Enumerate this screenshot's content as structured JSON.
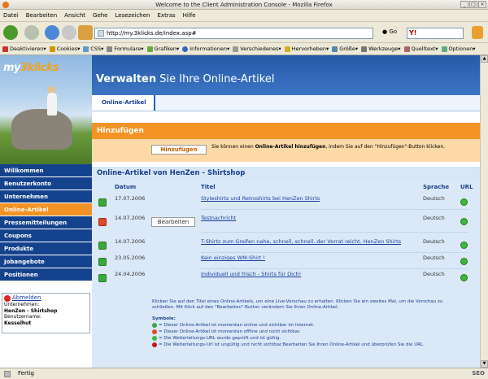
{
  "browser": {
    "title": "Welcome to the Client Administration Console - Mozilla Firefox",
    "menu": [
      "Datei",
      "Bearbeiten",
      "Ansicht",
      "Gehe",
      "Lesezeichen",
      "Extras",
      "Hilfe"
    ],
    "url": "http://my.3klicks.de/index.asp#",
    "go_label": "Go",
    "toolbar": [
      "Deaktivieren▾",
      "Cookies▾",
      "CSS▾",
      "Formulare▾",
      "Grafiken▾",
      "Informationen▾",
      "Verschiedenes▾",
      "Hervorheben▾",
      "Größe▾",
      "Werkzeuge▾",
      "Quelltext▾",
      "Optionen▾"
    ],
    "status": "Fertig",
    "status_right": "SEO"
  },
  "site": {
    "logo_a": "my",
    "logo_b": "3klicks",
    "header_bold": "Verwalten",
    "header_rest": " Sie Ihre Online-Artikel",
    "tab": "Online-Artikel",
    "nav": [
      {
        "label": "Willkommen",
        "active": false
      },
      {
        "label": "Benutzerkonto",
        "active": false
      },
      {
        "label": "Unternehmen",
        "active": false
      },
      {
        "label": "Online-Artikel",
        "active": true
      },
      {
        "label": "Pressemitteilungen",
        "active": false
      },
      {
        "label": "Coupons",
        "active": false
      },
      {
        "label": "Produkte",
        "active": false
      },
      {
        "label": "Jobangebote",
        "active": false
      },
      {
        "label": "Positionen",
        "active": false
      }
    ],
    "logout": "Abmelden",
    "company_label": "Unternehmen:",
    "company": "HenZen - Shirtshop",
    "user_label": "Benutzername:",
    "user": "Kesselhut"
  },
  "add": {
    "heading": "Hinzufügen",
    "button": "Hinzufügen",
    "desc_1": "Sie können einen ",
    "desc_bold": "Online-Artikel hinzufügen",
    "desc_2": ", indem Sie auf den \"Hinzufügen\"-Button klicken."
  },
  "list": {
    "heading": "Online-Artikel von HenZen - Shirtshop",
    "columns": {
      "date": "Datum",
      "title": "Titel",
      "lang": "Sprache",
      "url": "URL"
    },
    "edit_button": "Bearbeiten",
    "rows": [
      {
        "status": "online",
        "date": "17.07.2006",
        "title": "Styleshirts und Retroshirts bei HenZen Shirts",
        "lang": "Deutsch"
      },
      {
        "status": "offline",
        "date": "14.07.2006",
        "title": "Testnachricht",
        "lang": "Deutsch"
      },
      {
        "status": "online",
        "date": "14.07.2006",
        "title": "T-Shirts zum Greifen nahe, schnell, schnell..der Vorrat reicht. HenZen Shirts",
        "lang": "Deutsch"
      },
      {
        "status": "online",
        "date": "23.05.2006",
        "title": "Kein einziges WM-Shirt !",
        "lang": "Deutsch"
      },
      {
        "status": "online",
        "date": "24.04.2006",
        "title": "Individuell und frisch - Shirts für Dich!",
        "lang": "Deutsch"
      }
    ],
    "hint": "Klicken Sie auf den Titel eines Online-Artikels, um eine Live-Vorschau zu erhalten. Klicken Sie ein zweites Mal, um die Vorschau zu schließen. Mit Klick auf den \"Bearbeiten\"-Button verändern Sie Ihren Online-Artikel.",
    "legend_title": "Symbole:",
    "legend": [
      "= Dieser Online-Artikel ist momentan online und sichtbar im Internet.",
      "= Dieser Online-Artikel ist momentan offline und nicht sichtbar.",
      "= Die Weiterleitungs-URL wurde geprüft und ist gültig.",
      "= Die Weiterleitungs-Url ist ungültig und nicht sichtbar.Bearbeiten Sie Ihren Online-Artikel und überprüfen Sie die URL."
    ]
  },
  "colors": {
    "nav_blue": "#14428c",
    "accent_orange": "#f39325",
    "online": "#3aa83a",
    "offline": "#e04a2a"
  }
}
